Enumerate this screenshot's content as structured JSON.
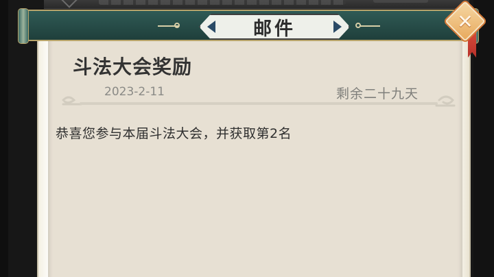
{
  "dialog": {
    "title": "邮件",
    "close_symbol": "✕"
  },
  "mail": {
    "subject": "斗法大会奖励",
    "date": "2023-2-11",
    "remaining": "剩余二十九天",
    "body": "恭喜您参与本届斗法大会，并获取第2名"
  },
  "icons": {
    "close": "close-icon",
    "cloud": "cloud-divider-icon"
  },
  "colors": {
    "header_teal": "#2f5a55",
    "paper": "#e7e0d3",
    "close_orange": "#e7a75a",
    "ribbon_red": "#c43a2f"
  }
}
